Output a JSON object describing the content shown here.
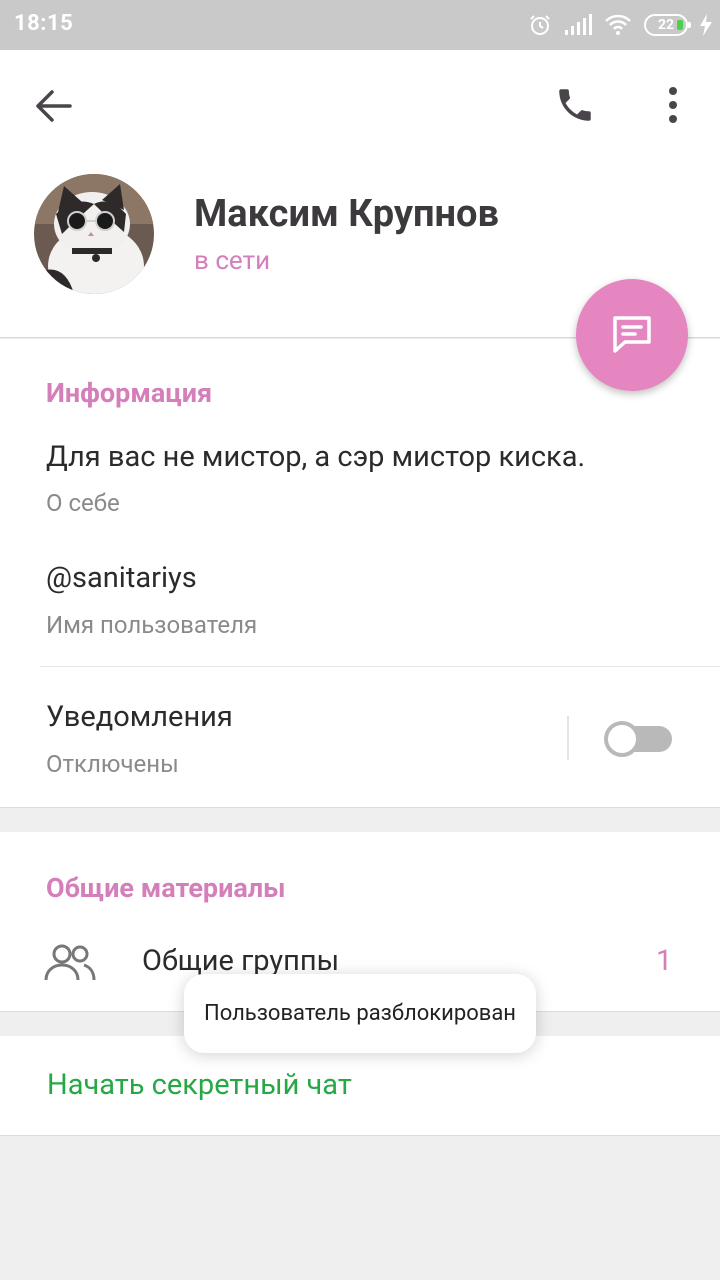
{
  "status_bar": {
    "time": "18:15",
    "battery_level": "22",
    "icons": [
      "alarm-icon",
      "signal-icon",
      "wifi-icon",
      "battery-icon",
      "charging-icon"
    ]
  },
  "header": {
    "back_icon": "arrow-left-icon",
    "call_icon": "phone-icon",
    "menu_icon": "more-vertical-icon"
  },
  "profile": {
    "name": "Максим Крупнов",
    "status": "в сети",
    "avatar": "cat-with-sunglasses"
  },
  "fab": {
    "icon": "message-icon"
  },
  "info": {
    "title": "Информация",
    "bio": "Для вас не мистор, а сэр мистор киска.",
    "bio_label": "О себе",
    "username": "@sanitariys",
    "username_label": "Имя пользователя",
    "notifications": "Уведомления",
    "notifications_status": "Отключены",
    "notifications_enabled": false
  },
  "shared": {
    "title": "Общие материалы",
    "groups_label": "Общие группы",
    "groups_count": "1",
    "groups_icon": "people-icon"
  },
  "secret_chat": {
    "label": "Начать секретный чат"
  },
  "toast": {
    "text": "Пользователь разблокирован"
  },
  "colors": {
    "accent": "#d57fba",
    "fab": "#e586c1",
    "secret": "#28a745",
    "status_bar": "#c9c9c9"
  }
}
